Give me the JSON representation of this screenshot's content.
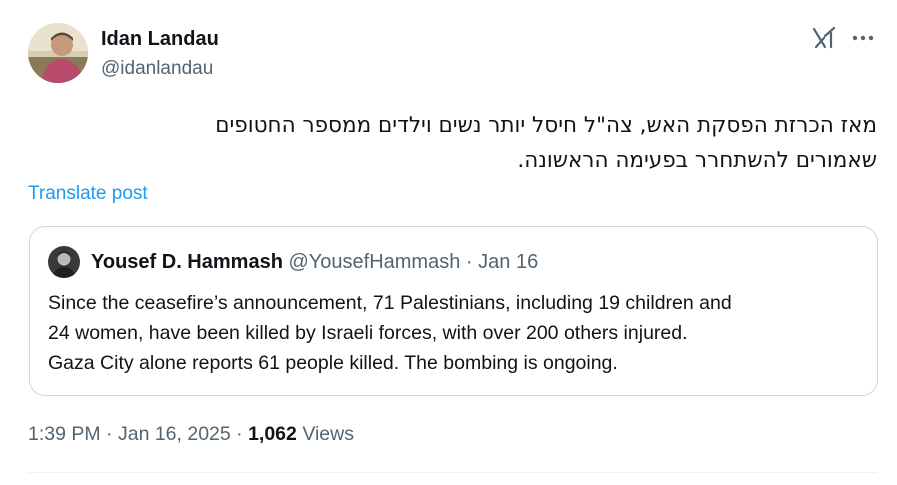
{
  "author": {
    "name": "Idan Landau",
    "handle": "@idanlandau",
    "avatar_icon": "person-avatar"
  },
  "post": {
    "lines": [
      "מאז הכרזת הפסקת האש, צה\"ל חיסל יותר נשים וילדים ממספר החטופים",
      "שאמורים להשתחרר בפעימה הראשונה."
    ],
    "translate_label": "Translate post"
  },
  "header_icons": {
    "grok": "grok-icon",
    "more": "more-options-icon"
  },
  "quote": {
    "name": "Yousef D. Hammash",
    "handle": "@YousefHammash",
    "separator": "·",
    "date": "Jan 16",
    "lines": [
      "Since the ceasefire’s announcement, 71 Palestinians, including 19 children and",
      "24 women, have been killed by Israeli forces, with over 200 others injured.",
      "Gaza City alone reports 61 people killed. The bombing is ongoing."
    ]
  },
  "meta": {
    "time": "1:39 PM",
    "sep1": "·",
    "date": "Jan 16, 2025",
    "sep2": "·",
    "views_count": "1,062",
    "views_label": "Views"
  },
  "colors": {
    "text": "#0f1419",
    "secondary": "#536471",
    "link": "#1d9bf0",
    "border": "#cfd9de"
  }
}
